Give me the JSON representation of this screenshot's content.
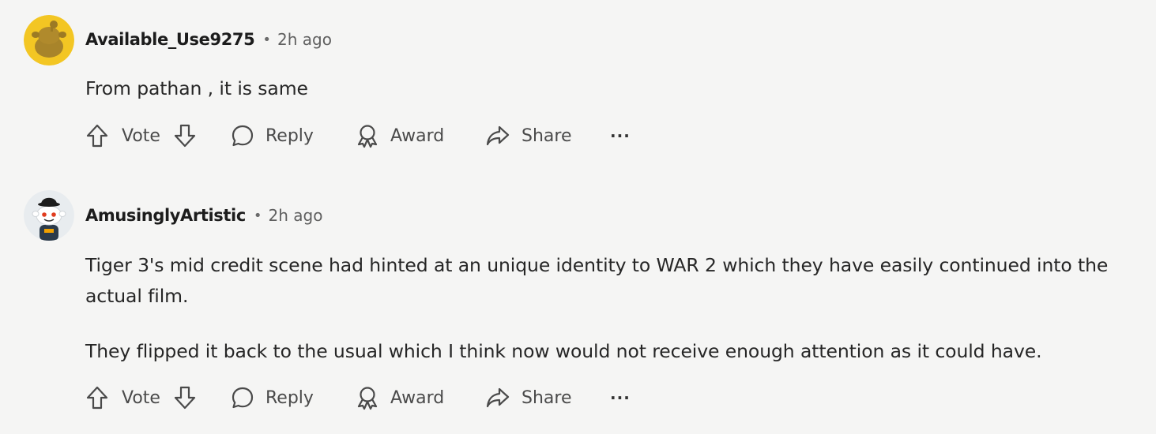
{
  "comments": [
    {
      "username": "Available_Use9275",
      "separator": "•",
      "time": "2h ago",
      "avatar_icon": "snoo-yellow-avatar",
      "avatar_color": "#f3c623",
      "paragraphs": [
        "From pathan , it is same"
      ],
      "actions": {
        "vote": "Vote",
        "reply": "Reply",
        "award": "Award",
        "share": "Share",
        "more": "···"
      }
    },
    {
      "username": "AmusinglyArtistic",
      "separator": "•",
      "time": "2h ago",
      "avatar_icon": "snoo-bowler-hat-avatar",
      "avatar_color": "#e8ecef",
      "paragraphs": [
        "Tiger 3's mid credit scene had hinted at an unique identity to WAR 2 which they have easily continued into the actual film.",
        "They flipped it back to the usual which I think now would not receive enough attention as it could have."
      ],
      "actions": {
        "vote": "Vote",
        "reply": "Reply",
        "award": "Award",
        "share": "Share",
        "more": "···"
      }
    }
  ]
}
